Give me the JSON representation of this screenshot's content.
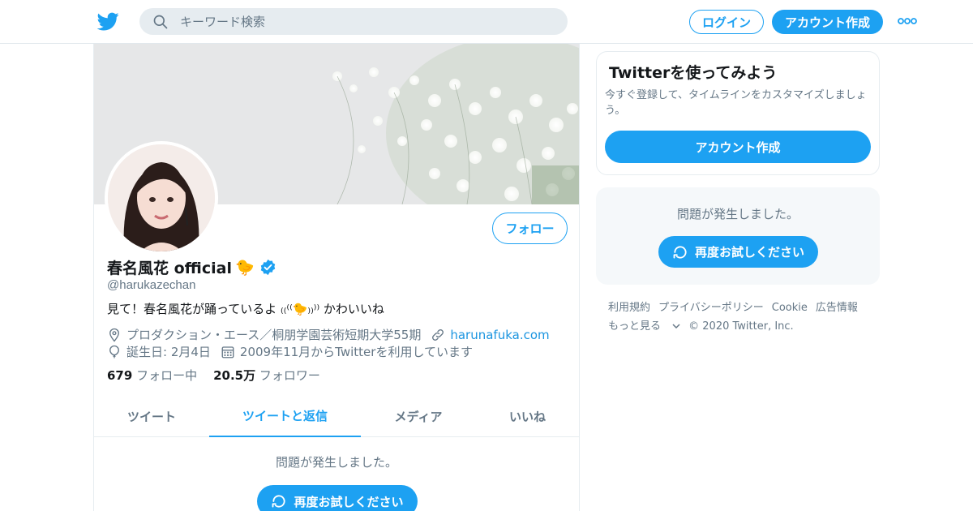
{
  "header": {
    "search_placeholder": "キーワード検索",
    "login_label": "ログイン",
    "signup_label": "アカウント作成"
  },
  "profile": {
    "display_name": "春名風花 official",
    "display_emoji": "🐤",
    "handle": "@harukazechan",
    "bio": "見て！春名風花が踊っているよ ₍₍⁽⁽🐤₎₎⁾⁾ かわいいね",
    "location": "プロダクション・エース／桐朋学園芸術短期大学55期",
    "website": "harunafuka.com",
    "birthday": "誕生日: 2月4日",
    "joined": "2009年11月からTwitterを利用しています",
    "following_count": "679",
    "following_label": "フォロー中",
    "followers_count": "20.5万",
    "followers_label": "フォロワー",
    "follow_button": "フォロー"
  },
  "tabs": [
    {
      "label": "ツイート",
      "active": false
    },
    {
      "label": "ツイートと返信",
      "active": true
    },
    {
      "label": "メディア",
      "active": false
    },
    {
      "label": "いいね",
      "active": false
    }
  ],
  "timeline": {
    "error_text": "問題が発生しました。",
    "retry_label": "再度お試しください"
  },
  "sidebar": {
    "signup_card": {
      "title": "Twitterを使ってみよう",
      "description": "今すぐ登録して、タイムラインをカスタマイズしましょう。",
      "button": "アカウント作成"
    },
    "error_card": {
      "error_text": "問題が発生しました。",
      "retry_label": "再度お試しください"
    },
    "footer": {
      "links": [
        "利用規約",
        "プライバシーポリシー",
        "Cookie",
        "広告情報",
        "もっと見る"
      ],
      "copyright": "© 2020 Twitter, Inc."
    }
  },
  "colors": {
    "accent": "#1da1f2",
    "text_primary": "#14171a",
    "text_secondary": "#657786",
    "border": "#e6ecf0"
  }
}
